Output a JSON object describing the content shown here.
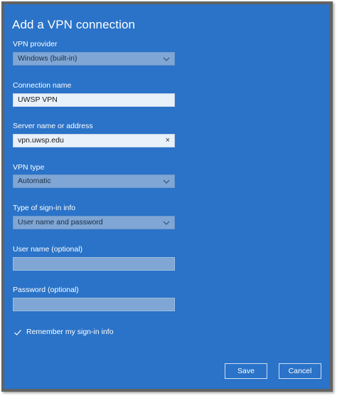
{
  "dialog": {
    "title": "Add a VPN connection"
  },
  "form": {
    "vpn_provider": {
      "label": "VPN provider",
      "value": "Windows (built-in)"
    },
    "connection_name": {
      "label": "Connection name",
      "value": "UWSP VPN"
    },
    "server": {
      "label": "Server name or address",
      "value": "vpn.uwsp.edu",
      "clear_icon": "×"
    },
    "vpn_type": {
      "label": "VPN type",
      "value": "Automatic"
    },
    "signin_type": {
      "label": "Type of sign-in info",
      "value": "User name and password"
    },
    "username": {
      "label": "User name (optional)",
      "value": ""
    },
    "password": {
      "label": "Password (optional)",
      "value": ""
    },
    "remember": {
      "label": "Remember my sign-in info",
      "checked": true
    }
  },
  "buttons": {
    "save": "Save",
    "cancel": "Cancel"
  },
  "colors": {
    "dialog_bg": "#2a73c8",
    "select_bg": "#7fa6d4",
    "input_bg": "#e8f0fa",
    "text": "#ffffff"
  }
}
